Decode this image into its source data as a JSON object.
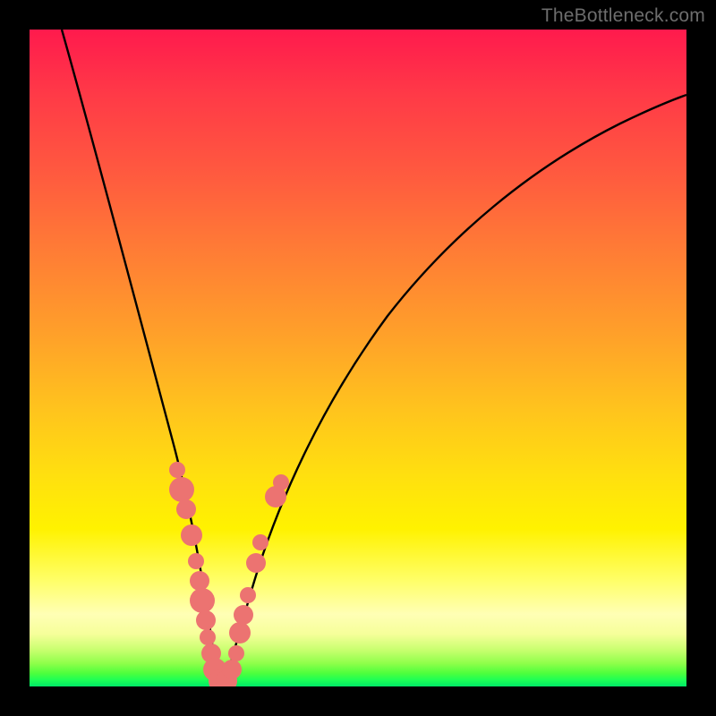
{
  "watermark": "TheBottleneck.com",
  "colors": {
    "frame": "#000000",
    "curve": "#000000",
    "marker": "#ec7371",
    "gradient_stops": [
      "#ff1a4d",
      "#ff7d35",
      "#ffe00f",
      "#ffffb5",
      "#1eff55"
    ]
  },
  "chart_data": {
    "type": "line",
    "title": "",
    "xlabel": "",
    "ylabel": "",
    "xlim": [
      0,
      100
    ],
    "ylim": [
      0,
      100
    ],
    "note": "V-shaped bottleneck curve; x is component scale (0-100), y is bottleneck percentage (0 at minimum, 100 at top). Values estimated from pixel positions since no ticks or labels are rendered.",
    "series": [
      {
        "name": "bottleneck-curve",
        "x": [
          5,
          8,
          12,
          16,
          19,
          22,
          24,
          26,
          27.5,
          29,
          30.5,
          32,
          36,
          40,
          46,
          54,
          64,
          78,
          94,
          100
        ],
        "y": [
          100,
          86,
          70,
          54,
          42,
          30,
          20,
          10,
          3,
          0,
          3,
          10,
          24,
          35,
          48,
          60,
          70,
          80,
          87,
          89
        ]
      }
    ],
    "markers": {
      "note": "Coral dot clusters along both arms near the valley; (x, y, r) with r in axis units.",
      "points": [
        [
          22.5,
          33,
          1.3
        ],
        [
          23.2,
          30,
          1.9
        ],
        [
          23.8,
          27,
          1.5
        ],
        [
          24.6,
          23,
          1.7
        ],
        [
          25.3,
          19,
          1.3
        ],
        [
          25.8,
          16,
          1.5
        ],
        [
          26.3,
          13,
          1.9
        ],
        [
          26.8,
          10,
          1.5
        ],
        [
          27.1,
          7.5,
          1.3
        ],
        [
          27.6,
          5,
          1.5
        ],
        [
          28.2,
          2.5,
          1.8
        ],
        [
          29.0,
          0.7,
          1.8
        ],
        [
          30.0,
          0.7,
          1.7
        ],
        [
          30.8,
          2.5,
          1.5
        ],
        [
          31.4,
          5,
          1.3
        ],
        [
          32.0,
          8,
          1.7
        ],
        [
          32.6,
          11,
          1.5
        ],
        [
          33.3,
          14,
          1.3
        ],
        [
          34.4,
          19,
          1.5
        ],
        [
          35.2,
          22,
          1.3
        ],
        [
          37.5,
          29,
          1.7
        ],
        [
          38.2,
          31,
          1.3
        ]
      ]
    }
  }
}
